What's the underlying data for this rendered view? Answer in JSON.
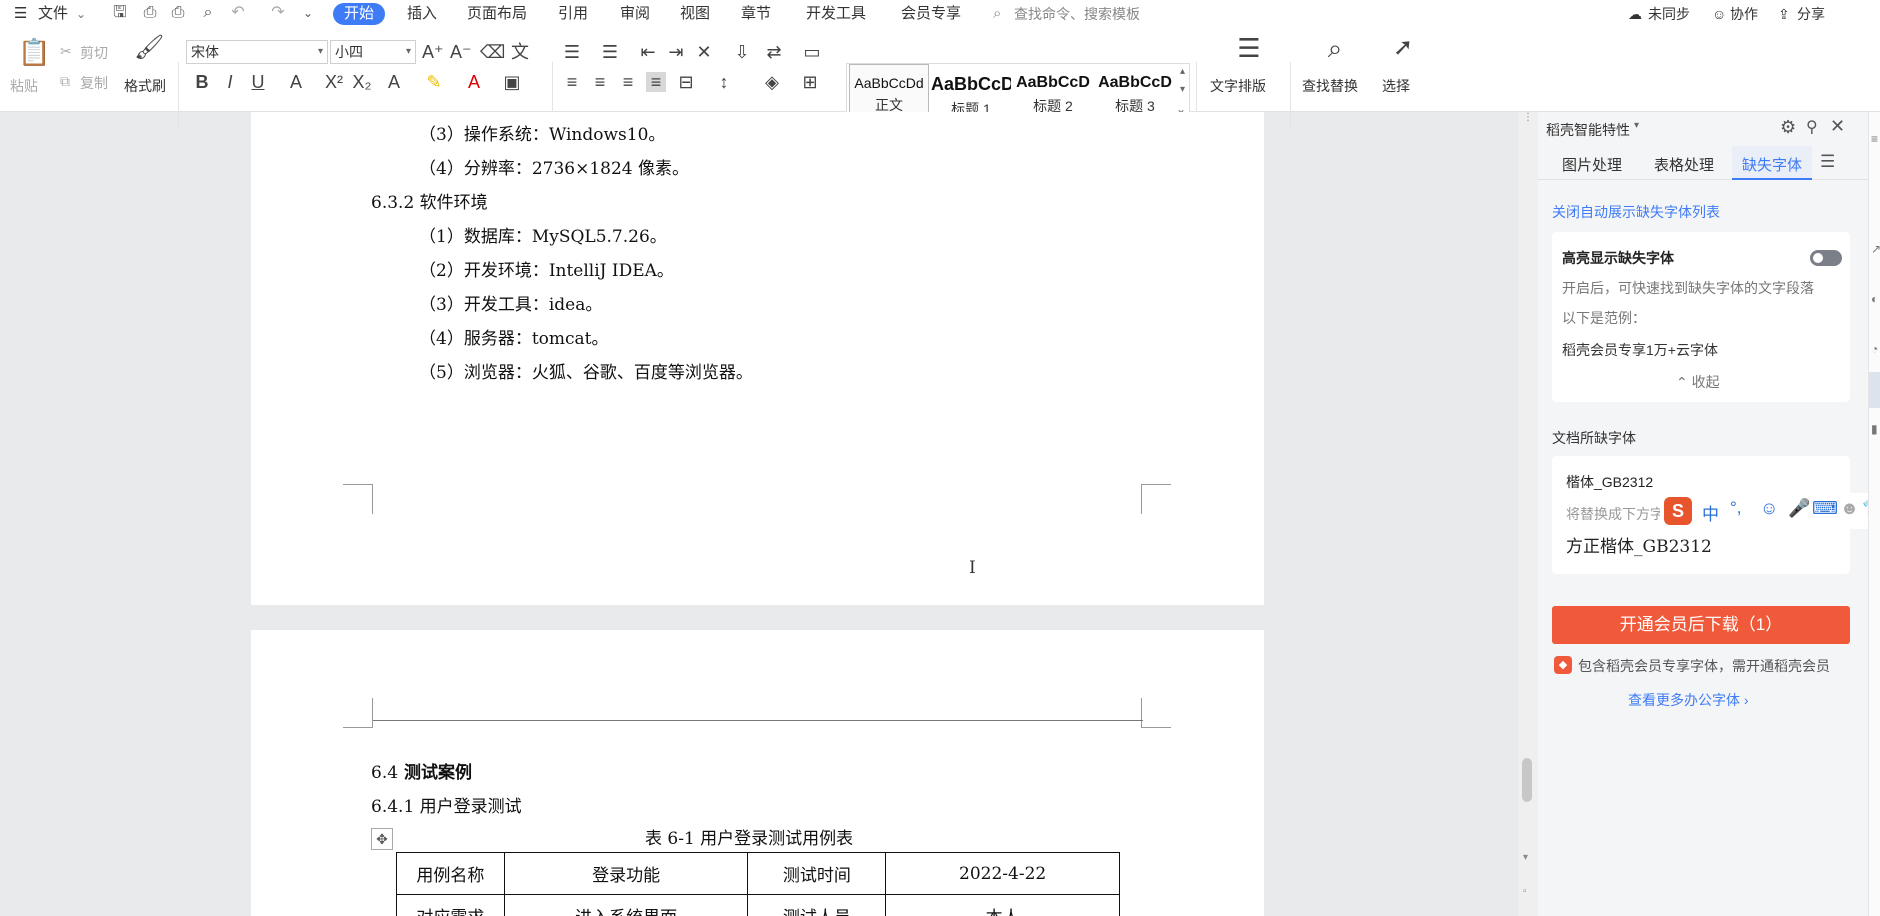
{
  "menu": {
    "file": "文件",
    "tabs": [
      "开始",
      "插入",
      "页面布局",
      "引用",
      "审阅",
      "视图",
      "章节",
      "开发工具",
      "会员专享"
    ],
    "search_placeholder": "查找命令、搜索模板",
    "unsynced": "未同步",
    "collab": "协作",
    "share": "分享"
  },
  "ribbon": {
    "paste": "粘贴",
    "cut": "剪切",
    "copy": "复制",
    "format_painter": "格式刷",
    "font_name": "宋体",
    "font_size": "小四",
    "styles": [
      {
        "preview": "AaBbCcDd",
        "name": "正文"
      },
      {
        "preview": "AaBbCcD",
        "name": "标题 1"
      },
      {
        "preview": "AaBbCcD",
        "name": "标题 2"
      },
      {
        "preview": "AaBbCcD",
        "name": "标题 3"
      }
    ],
    "text_layout": "文字排版",
    "find_replace": "查找替换",
    "select": "选择"
  },
  "doc": {
    "lines": [
      "（3）操作系统：Windows10。",
      "（4）分辨率：2736×1824 像素。",
      "6.3.2 软件环境",
      "（1）数据库：MySQL5.7.26。",
      "（2）开发环境：IntelliJ IDEA。",
      "（3）开发工具：idea。",
      "（4）服务器：tomcat。",
      "（5）浏览器：火狐、谷歌、百度等浏览器。"
    ],
    "sec_num": "6.4",
    "sec_title": "测试案例",
    "sub_heading": "6.4.1 用户登录测试",
    "table_caption": "表 6-1 用户登录测试用例表",
    "table_row1": [
      "用例名称",
      "登录功能",
      "测试时间",
      "2022-4-22"
    ],
    "table_row2": [
      "对应需求",
      "进入系统界面",
      "测试人员",
      "本人"
    ]
  },
  "panel": {
    "title": "稻壳智能特性",
    "tabs": [
      "图片处理",
      "表格处理",
      "缺失字体"
    ],
    "close_auto": "关闭自动展示缺失字体列表",
    "highlight_title": "高亮显示缺失字体",
    "highlight_desc": "开启后，可快速找到缺失字体的文字段落",
    "example_label": "以下是范例：",
    "example_text": "稻壳会员专享1万+云字体",
    "collapse": "收起",
    "missing_title": "文档所缺字体",
    "missing_font": "楷体_GB2312",
    "replace_label": "将替换成下方字",
    "replacement_font": "方正楷体_GB2312",
    "download_button": "开通会员后下载（1）",
    "member_note": "包含稻壳会员专享字体，需开通稻壳会员",
    "more_fonts": "查看更多办公字体"
  },
  "ime": {
    "mode": "中",
    "punct": "°,"
  },
  "colors": {
    "accent": "#3e7bf6",
    "download": "#f05a3a",
    "ime": "#e8542c"
  }
}
